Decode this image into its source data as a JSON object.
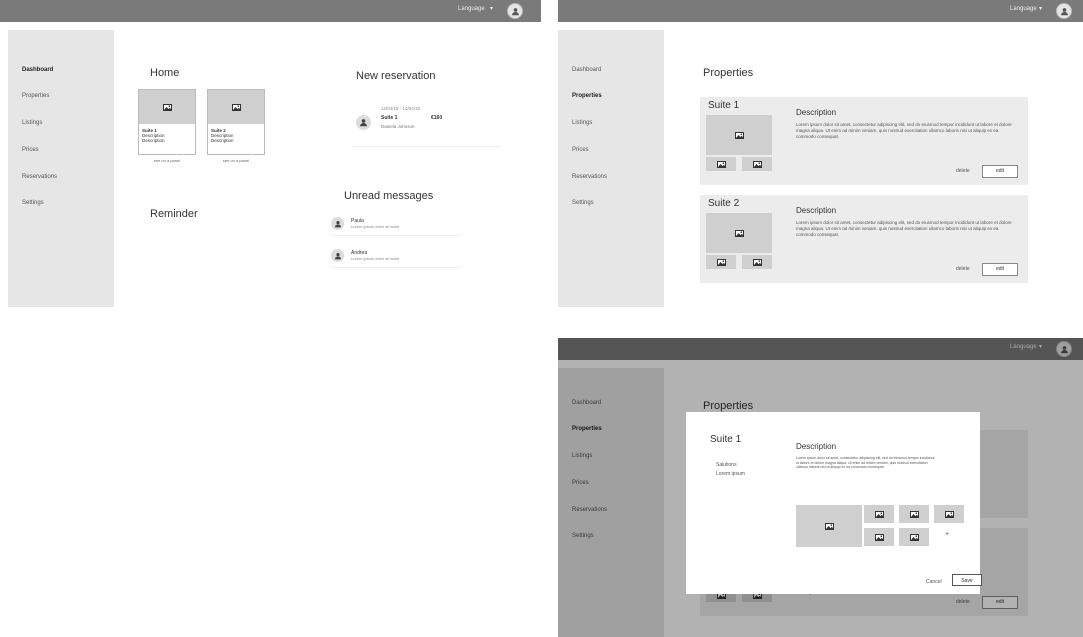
{
  "header": {
    "language_label": "Language"
  },
  "sidebar": {
    "items": [
      "Dashboard",
      "Properties",
      "Listings",
      "Prices",
      "Reservations",
      "Settings"
    ]
  },
  "dashboard": {
    "home_title": "Home",
    "cards": [
      {
        "title": "Suite 1",
        "line1": "Description",
        "line2": "Description",
        "caption": "see on a panel"
      },
      {
        "title": "Suite 2",
        "line1": "Description",
        "line2": "Description",
        "caption": "see on a panel"
      }
    ],
    "reminder_title": "Reminder",
    "new_reservation": {
      "title": "New reservation",
      "dates": "12/04/18 - 14/04/18",
      "suite": "Suite 1",
      "amount": "€160",
      "guest": "Daniela Johnson"
    },
    "unread": {
      "title": "Unread messages",
      "messages": [
        {
          "name": "Paula",
          "preview": "Lorem ipsum dolor sit amet"
        },
        {
          "name": "Andrea",
          "preview": "Lorem ipsum dolor sit amet"
        }
      ]
    }
  },
  "properties": {
    "title": "Properties",
    "items": [
      {
        "name": "Suite 1",
        "desc_title": "Description",
        "desc": "Lorem ipsum dolor sit amet, consectetur adipiscing elit, sed do eiusmod tempor incididunt ut labore et dolore magna aliqua. Ut enim ad minim veniam, quis nostrud exercitation ullamco laboris nisi ut aliquip ex ea commodo consequat.",
        "delete": "delete",
        "edit": "edit"
      },
      {
        "name": "Suite 2",
        "desc_title": "Description",
        "desc": "Lorem ipsum dolor sit amet, consectetur adipiscing elit, sed do eiusmod tempor incididunt ut labore et dolore magna aliqua. Ut enim ad minim veniam, quis nostrud exercitation ullamco laboris nisi ut aliquip ex ea commodo consequat.",
        "delete": "delete",
        "edit": "edit"
      }
    ]
  },
  "modal": {
    "title": "Suite 1",
    "sub1": "Salutions",
    "sub2": "Lorem ipsum",
    "desc_title": "Description",
    "desc": "Lorem ipsum dolor sit amet, consectetur adipiscing elit, sed do eiusmod tempor incididunt ut labore et dolore magna aliqua. Ut enim ad minim veniam, quis nostrud exercitation ullamco laboris nisi ut aliquip ex ea commodo consequat.",
    "add": "+",
    "cancel": "Cancel",
    "save": "Save",
    "bg_desc_tail": "consequat.",
    "bg_delete": "delete",
    "bg_edit": "edit"
  }
}
